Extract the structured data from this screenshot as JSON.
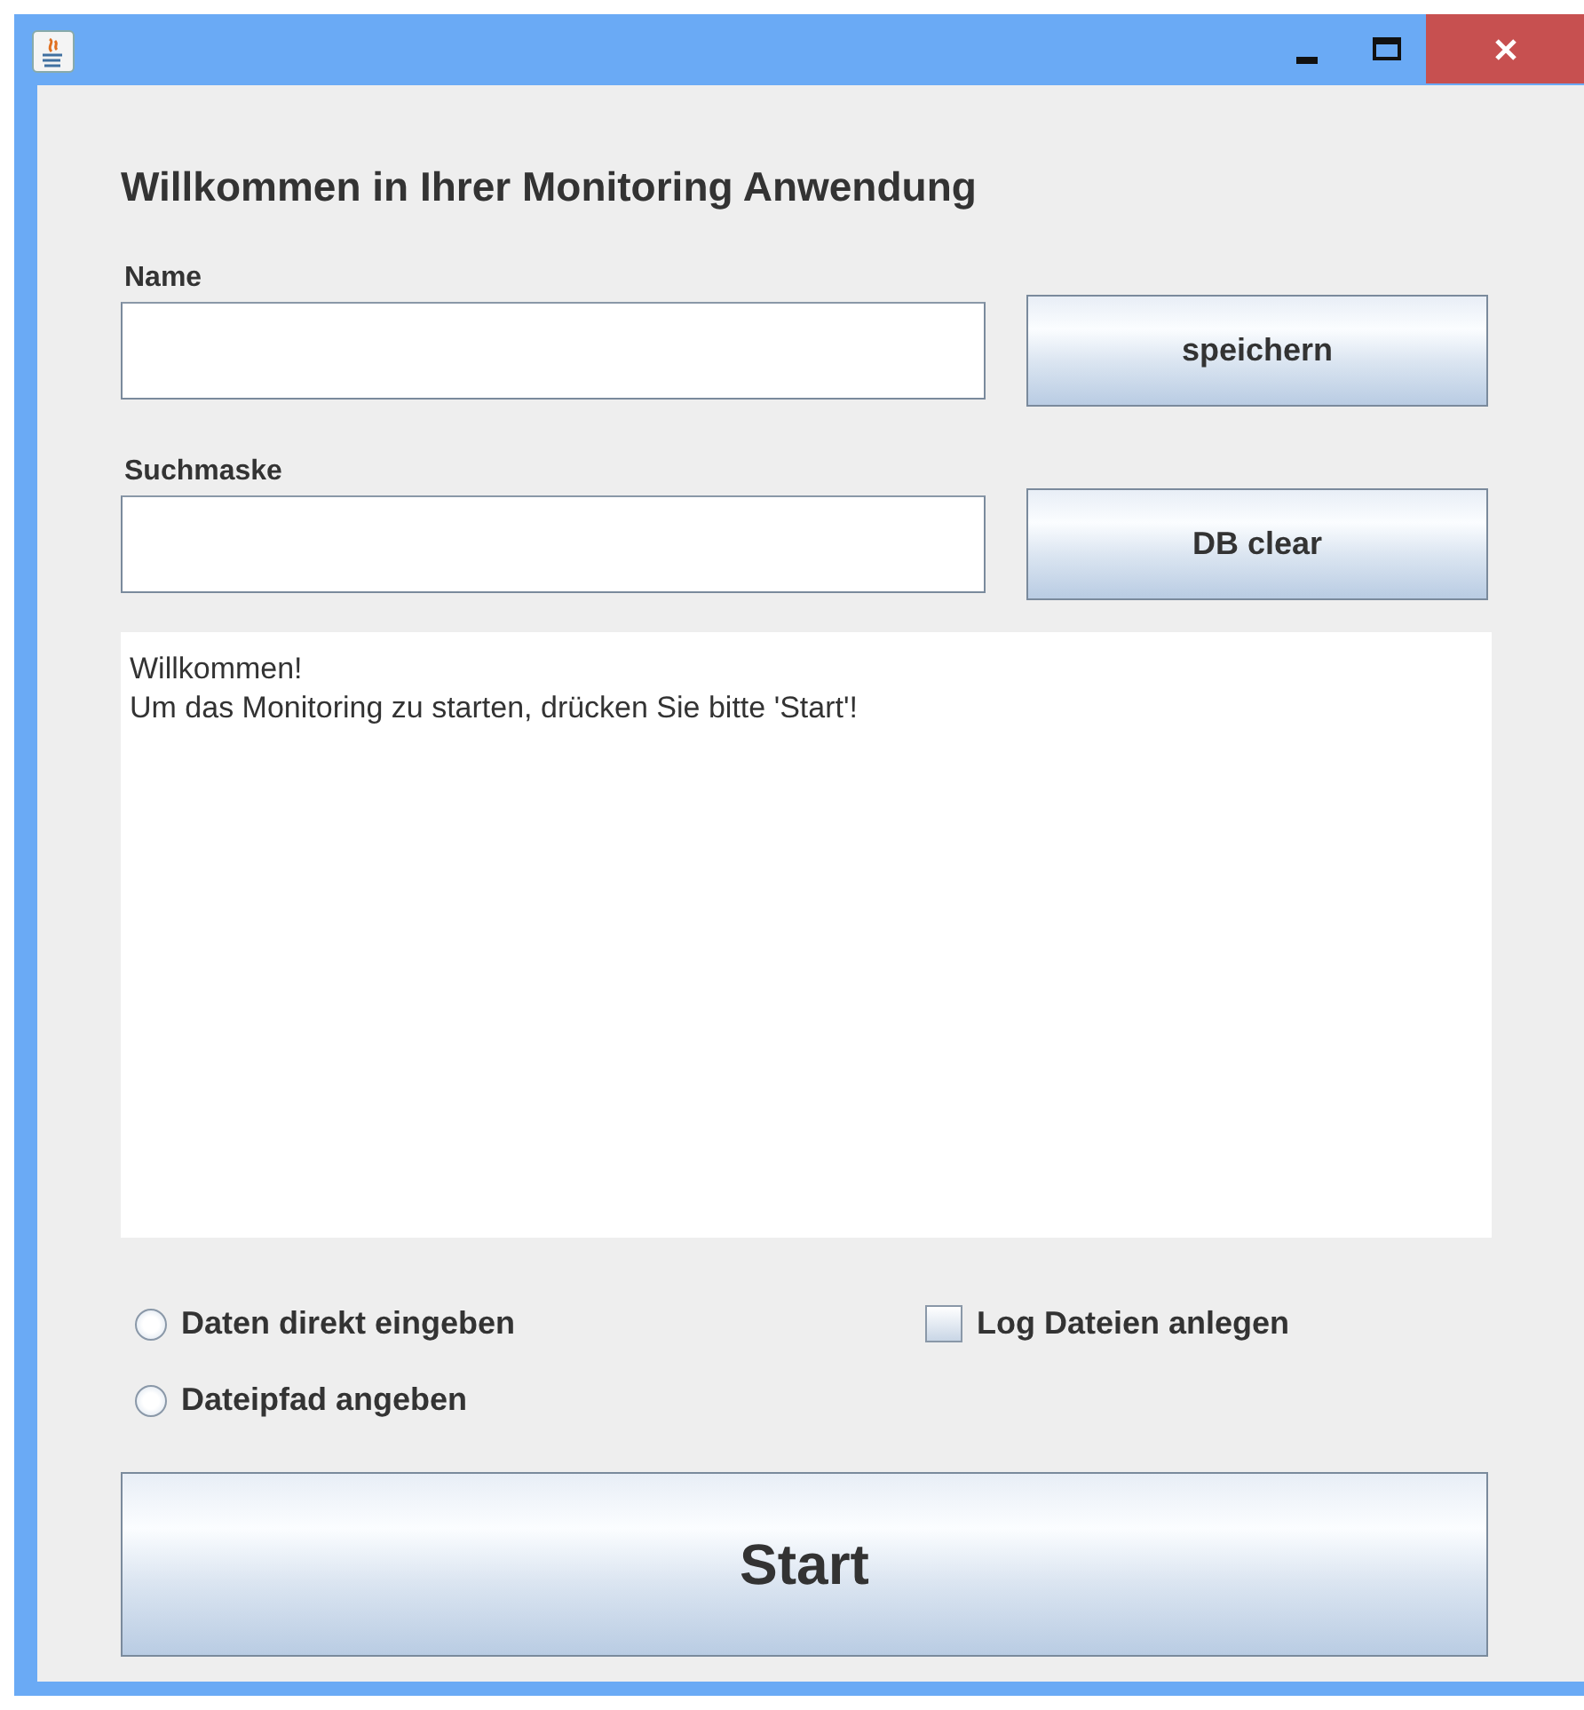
{
  "heading": "Willkommen in Ihrer Monitoring Anwendung",
  "fields": [
    {
      "label": "Name",
      "button": "speichern"
    },
    {
      "label": "Suchmaske",
      "button": "DB clear"
    }
  ],
  "log_text": [
    "Willkommen!",
    "Um das Monitoring zu starten, drücken Sie bitte 'Start'!"
  ],
  "options": [
    {
      "kind": "radio",
      "label": "Daten direkt eingeben",
      "selected": false
    },
    {
      "kind": "checkbox",
      "label": "Log Dateien anlegen",
      "checked": false
    },
    {
      "kind": "radio",
      "label": "Dateipfad angeben",
      "selected": false
    }
  ],
  "start_button": "Start"
}
